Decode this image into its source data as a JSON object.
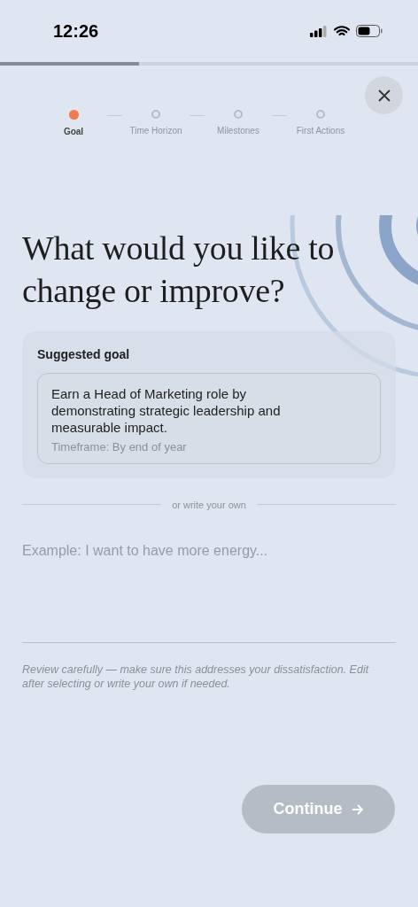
{
  "status_bar": {
    "time": "12:26"
  },
  "progress": {
    "level": 0.333
  },
  "steps": [
    {
      "label": "Goal",
      "selected": true
    },
    {
      "label": "Time Horizon",
      "selected": false
    },
    {
      "label": "Milestones",
      "selected": false
    },
    {
      "label": "First Actions",
      "selected": false
    }
  ],
  "heading": "What would you like to change or improve?",
  "suggested": {
    "title": "Suggested goal",
    "goal": "Earn a Head of Marketing role by demonstrating strategic leadership and measurable impact.",
    "timeframe": "Timeframe: By end of year"
  },
  "divider_label": "or write your own",
  "own_goal": {
    "placeholder": "Example: I want to have more energy..."
  },
  "note": "Review carefully — make sure this addresses your dissatisfaction. Edit after selecting or write your own if needed.",
  "continue_button": {
    "label": "Continue",
    "disabled": true
  }
}
